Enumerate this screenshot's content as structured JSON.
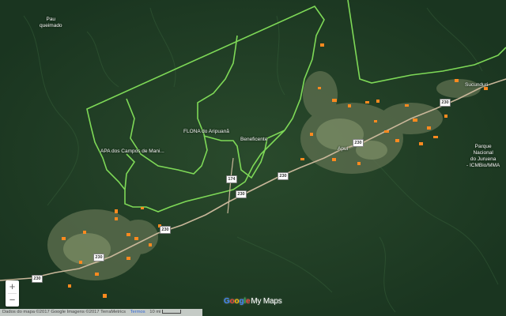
{
  "map": {
    "place_labels": [
      {
        "id": "pau-queimado",
        "text": "Pau\nqueimado"
      },
      {
        "id": "apa-campos-manicore",
        "text": "APA dos Campos de Mani..."
      },
      {
        "id": "flona-aripuana",
        "text": "FLONA do Aripuanã"
      },
      {
        "id": "beneficente",
        "text": "Beneficente"
      },
      {
        "id": "apui",
        "text": "Apuí"
      },
      {
        "id": "sucunduri",
        "text": "Sucunduri"
      },
      {
        "id": "parque-juruena",
        "text": "Parque\nNacional\ndo Juruena\n- ICMBio/MMA"
      }
    ],
    "road_shields": [
      {
        "id": "br230-a",
        "text": "230"
      },
      {
        "id": "br230-b",
        "text": "230"
      },
      {
        "id": "br230-c",
        "text": "230"
      },
      {
        "id": "br230-d",
        "text": "230"
      },
      {
        "id": "br230-e",
        "text": "230"
      },
      {
        "id": "br230-f",
        "text": "230"
      },
      {
        "id": "br230-g",
        "text": "230"
      },
      {
        "id": "am174",
        "text": "174"
      }
    ],
    "colors": {
      "forest": "#1f3d22",
      "deforested": "#6d7d5a",
      "boundary": "#7ed957",
      "fire_points": "#ff8a1f",
      "road": "#c9b79a"
    }
  },
  "controls": {
    "zoom_in": "+",
    "zoom_out": "−"
  },
  "branding": {
    "google": [
      "G",
      "o",
      "o",
      "g",
      "l",
      "e"
    ],
    "mymaps": "My Maps"
  },
  "footer": {
    "attribution": "Dados do mapa ©2017 Google Imagens ©2017 TerraMetrics",
    "terms": "Termos",
    "scale_label": "10 mi"
  }
}
